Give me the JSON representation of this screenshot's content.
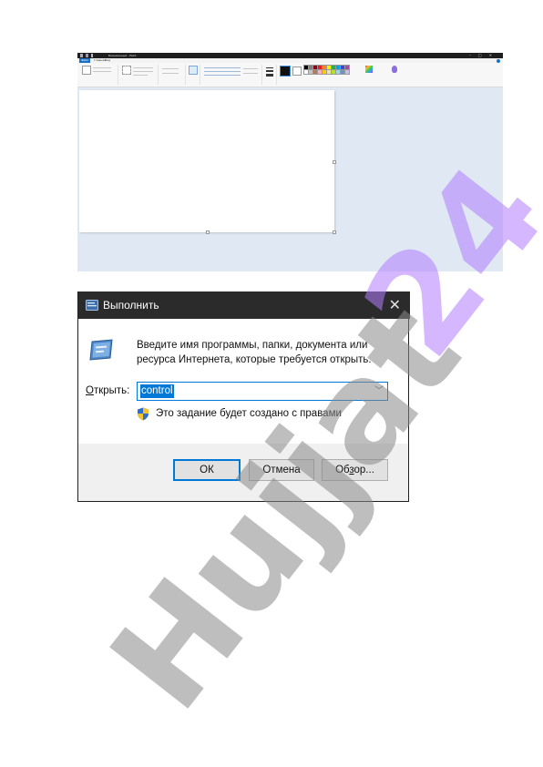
{
  "paint": {
    "window_title": "Безымянный - Paint",
    "tabs": [
      "Файл",
      "Главная",
      "Вид"
    ]
  },
  "run_dialog": {
    "title": "Выполнить",
    "close_glyph": "✕",
    "description": "Введите имя программы, папки, документа или ресурса Интернета, которые требуется открыть.",
    "open_label_prefix": "О",
    "open_label_rest": "ткрыть:",
    "input_value": "control",
    "admin_note": "Это задание будет создано с правами",
    "ok_label": "ОК",
    "cancel_label": "Отмена",
    "browse_label_a": "Об",
    "browse_label_u": "з",
    "browse_label_b": "ор..."
  },
  "watermark": {
    "purple_text": "24",
    "grey_text": "Hujjat"
  },
  "colors": {
    "dialog_titlebar": "#2b2b2b",
    "accent": "#0078d7",
    "watermark_purple": "#b27dff",
    "watermark_grey": "#8a8a8a"
  }
}
